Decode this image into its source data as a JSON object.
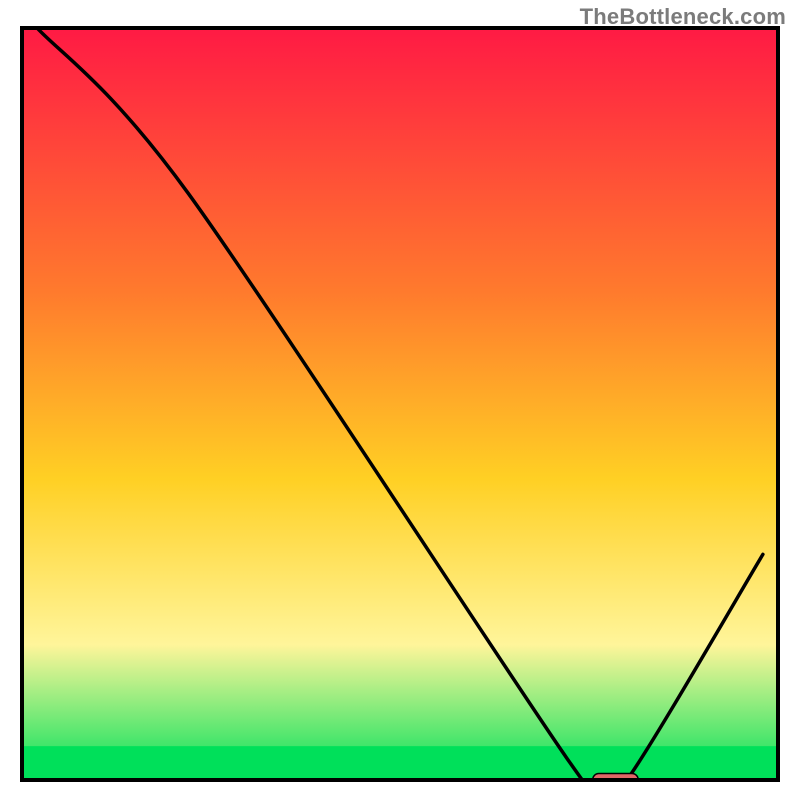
{
  "watermark": "TheBottleneck.com",
  "colors": {
    "gradient_top": "#ff1a44",
    "gradient_mid1": "#ff7a2d",
    "gradient_mid2": "#ffd024",
    "gradient_mid3": "#fff59a",
    "gradient_bottom": "#00e05a",
    "curve": "#000000",
    "marker_fill": "#e06666",
    "marker_stroke": "#000000",
    "frame": "#000000"
  },
  "chart_data": {
    "type": "line",
    "title": "",
    "xlabel": "",
    "ylabel": "",
    "x": [
      0.02,
      0.22,
      0.72,
      0.76,
      0.8,
      0.98
    ],
    "values": [
      1.0,
      0.78,
      0.03,
      0.0,
      0.0,
      0.3
    ],
    "xlim": [
      0,
      1
    ],
    "ylim": [
      0,
      1
    ],
    "marker": {
      "x_start": 0.755,
      "x_end": 0.815,
      "y": 0.0
    },
    "background": "vertical-gradient-red-orange-yellow-green",
    "green_band_top": 0.045
  }
}
